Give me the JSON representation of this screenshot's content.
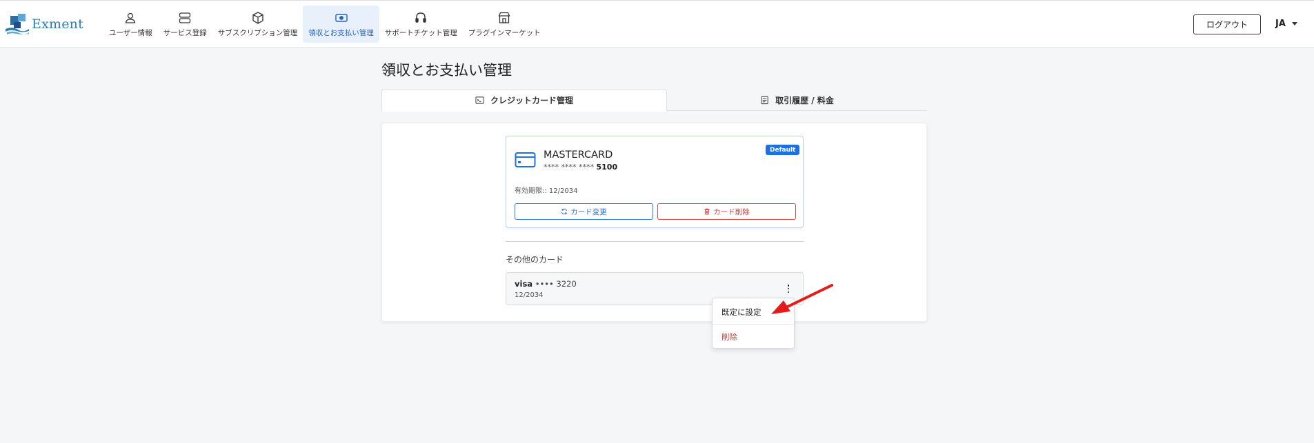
{
  "brand": {
    "name": "Exment"
  },
  "nav": {
    "items": [
      {
        "label": "ユーザー情報",
        "icon": "user-icon"
      },
      {
        "label": "サービス登録",
        "icon": "server-icon"
      },
      {
        "label": "サブスクリプション管理",
        "icon": "box-icon"
      },
      {
        "label": "領収とお支払い管理",
        "icon": "money-icon",
        "active": true
      },
      {
        "label": "サポートチケット管理",
        "icon": "headset-icon"
      },
      {
        "label": "プラグインマーケット",
        "icon": "shop-icon"
      }
    ],
    "logout_label": "ログアウト",
    "language": "JA"
  },
  "page": {
    "title": "領収とお支払い管理",
    "tabs": [
      {
        "label": "クレジットカード管理",
        "icon": "terminal-icon",
        "active": true
      },
      {
        "label": "取引履歴 / 料金",
        "icon": "receipt-icon",
        "active": false
      }
    ]
  },
  "default_card": {
    "brand": "MASTERCARD",
    "masked_prefix": "**** **** ****",
    "last4": "5100",
    "badge": "Default",
    "expiry_label": "有効期限:: 12/2034",
    "change_label": "カード変更",
    "delete_label": "カード削除"
  },
  "other_cards": {
    "title": "その他のカード",
    "items": [
      {
        "brand": "visa",
        "masked": "••••",
        "last4": "3220",
        "expiry": "12/2034"
      }
    ]
  },
  "dropdown": {
    "set_default_label": "既定に設定",
    "delete_label": "削除"
  },
  "colors": {
    "accent": "#1f6fe0",
    "danger": "#d73c3c",
    "annotation_arrow": "#e31b1b"
  }
}
